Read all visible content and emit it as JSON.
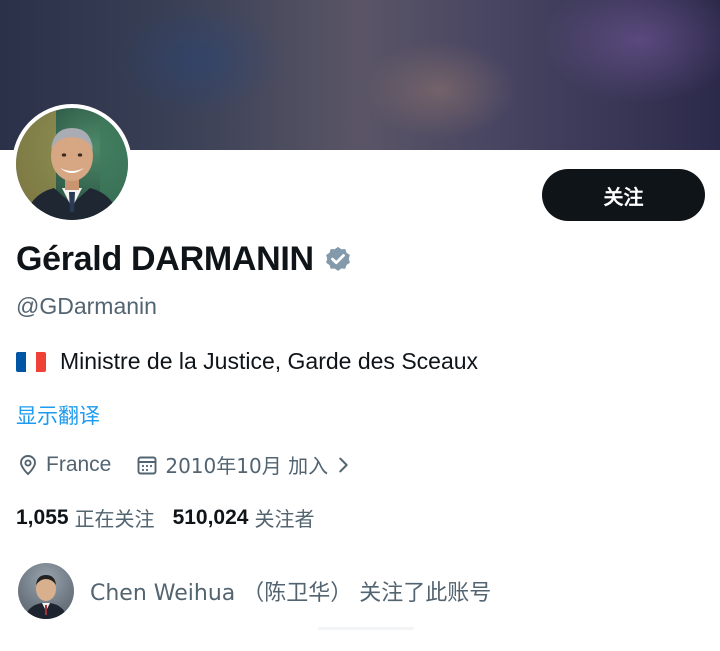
{
  "profile": {
    "display_name": "Gérald DARMANIN",
    "handle": "@GDarmanin",
    "bio": "Ministre de la Justice, Garde des Sceaux",
    "follow_label": "关注",
    "translate_label": "显示翻译",
    "location": "France",
    "joined": "2010年10月 加入",
    "following_count": "1,055",
    "following_label": "正在关注",
    "followers_count": "510,024",
    "followers_label": "关注者",
    "followed_by": "Chen Weihua （陈卫华） 关注了此账号"
  },
  "icons": {
    "verified": "verified-badge-icon",
    "flag": "france-flag-icon",
    "location": "location-pin-icon",
    "calendar": "calendar-icon",
    "chevron": "chevron-right-icon"
  },
  "colors": {
    "follow_button_bg": "#0f1419",
    "link": "#1d9bf0",
    "secondary_text": "#536471",
    "verified_badge": "#829aab"
  }
}
